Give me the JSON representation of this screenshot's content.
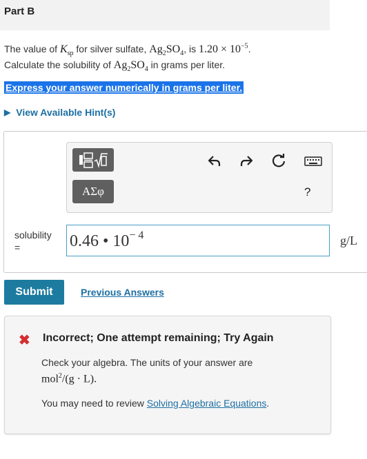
{
  "part": {
    "title": "Part B"
  },
  "question": {
    "intro": "The value of ",
    "k_main": "K",
    "k_sub": "sp",
    "mid1": " for silver sulfate, ",
    "formula_ag": "Ag",
    "formula_ag_sub": "2",
    "formula_so": "SO",
    "formula_so_sub": "4",
    "mid2": ", is ",
    "value_mantissa": "1.20 × 10",
    "value_exp": "−5",
    "end1": ".",
    "line2_pre": "Calculate the solubility of ",
    "line2_post": " in grams per liter."
  },
  "instruction": "Express your answer numerically in grams per liter.",
  "hint": {
    "label": "View Available Hint(s)"
  },
  "toolbar": {
    "symbols_label": "ΑΣφ",
    "help_label": "?",
    "icons": [
      "templates-icon",
      "undo-icon",
      "redo-icon",
      "reset-icon",
      "keyboard-icon"
    ]
  },
  "answer": {
    "label_line1": "solubility",
    "label_line2": "=",
    "value_main": "0.46 • 10",
    "value_exp": "− 4",
    "unit": "g/L"
  },
  "actions": {
    "submit_label": "Submit",
    "previous_label": "Previous Answers"
  },
  "feedback": {
    "title": "Incorrect; One attempt remaining; Try Again",
    "text": "Check your algebra. The units of your answer are",
    "units_main": "mol",
    "units_exp": "2",
    "units_rest": "/(g · L).",
    "review_pre": "You may need to review ",
    "review_link": "Solving Algebraic Equations",
    "review_post": ".",
    "icon_color": "#d32f2f"
  },
  "colors": {
    "accent_blue": "#1a73e8",
    "link_blue": "#1d6fa3",
    "submit_bg": "#1d7ba0"
  }
}
